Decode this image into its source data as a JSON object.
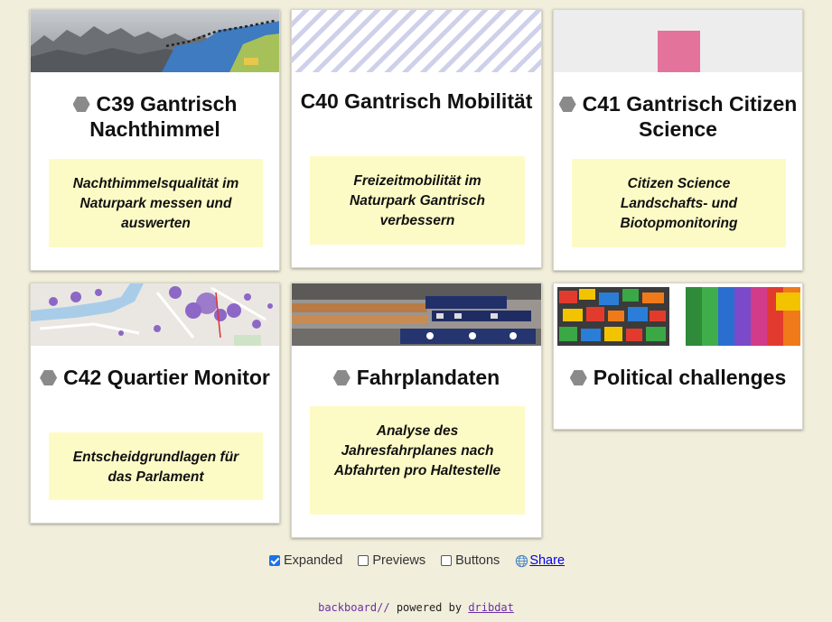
{
  "projects": [
    {
      "title": "C39 Gantrisch Nachthimmel",
      "summary": "Nachthimmelsqualität im Naturpark messen und auswerten"
    },
    {
      "title": "C40 Gantrisch Mobilität",
      "summary": "Freizeitmobilität im Naturpark Gantrisch verbessern"
    },
    {
      "title": "C41 Gantrisch Citizen Science",
      "summary": "Citizen Science Landschafts- und Biotopmonitoring"
    },
    {
      "title": "C42 Quartier Monitor",
      "summary": "Entscheidgrundlagen für das Parlament"
    },
    {
      "title": "Fahrplandaten",
      "summary": "Analyse des Jahresfahrplanes nach Abfahrten pro Haltestelle"
    },
    {
      "title": "Political challenges",
      "summary": ""
    }
  ],
  "controls": {
    "expanded": {
      "label": "Expanded",
      "checked": true
    },
    "previews": {
      "label": "Previews",
      "checked": false
    },
    "buttons": {
      "label": "Buttons",
      "checked": false
    },
    "share": {
      "label": "Share",
      "icon": "globe-icon"
    }
  },
  "footer": {
    "brand": "backboard//",
    "middle": "powered by",
    "link": "dribdat"
  },
  "colors": {
    "background": "#f1eedb",
    "summary_bg": "#fdfbc5",
    "accent": "#1a73e8",
    "footer_link": "#6b2fa6"
  }
}
